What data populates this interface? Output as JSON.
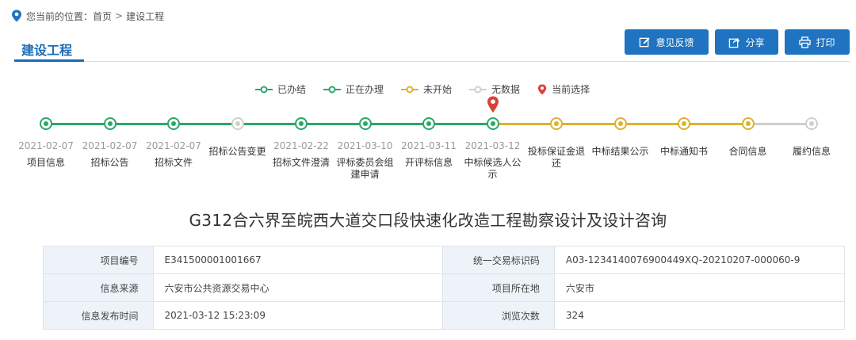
{
  "breadcrumb": {
    "prefix": "您当前的位置：",
    "home": "首页",
    "separator": ">",
    "current": "建设工程"
  },
  "section": {
    "title": "建设工程"
  },
  "actions": {
    "feedback": "意见反馈",
    "share": "分享",
    "print": "打印"
  },
  "legend": {
    "done": "已办结",
    "in_progress": "正在办理",
    "not_started": "未开始",
    "no_data": "无数据",
    "current": "当前选择"
  },
  "colors": {
    "done": "#2aa866",
    "not_started": "#e0b12b",
    "no_data": "#cfcfcf",
    "marker": "#d9423a",
    "accent": "#1f73c0"
  },
  "timeline": {
    "steps": [
      {
        "date": "2021-02-07",
        "label": "项目信息",
        "status": "done"
      },
      {
        "date": "2021-02-07",
        "label": "招标公告",
        "status": "done"
      },
      {
        "date": "2021-02-07",
        "label": "招标文件",
        "status": "done"
      },
      {
        "date": "",
        "label": "招标公告变更",
        "status": "no_data"
      },
      {
        "date": "2021-02-22",
        "label": "招标文件澄清",
        "status": "done"
      },
      {
        "date": "2021-03-10",
        "label": "评标委员会组建申请",
        "status": "done"
      },
      {
        "date": "2021-03-11",
        "label": "开评标信息",
        "status": "done"
      },
      {
        "date": "2021-03-12",
        "label": "中标候选人公示",
        "status": "done"
      },
      {
        "date": "",
        "label": "投标保证金退还",
        "status": "not_started"
      },
      {
        "date": "",
        "label": "中标结果公示",
        "status": "not_started"
      },
      {
        "date": "",
        "label": "中标通知书",
        "status": "not_started"
      },
      {
        "date": "",
        "label": "合同信息",
        "status": "not_started"
      },
      {
        "date": "",
        "label": "履约信息",
        "status": "no_data"
      }
    ]
  },
  "project": {
    "title": "G312合六界至皖西大道交口段快速化改造工程勘察设计及设计咨询"
  },
  "info": {
    "project_no_label": "项目编号",
    "project_no": "E341500001001667",
    "trade_id_label": "统一交易标识码",
    "trade_id": "A03-1234140076900449XQ-20210207-000060-9",
    "source_label": "信息来源",
    "source": "六安市公共资源交易中心",
    "location_label": "项目所在地",
    "location": "六安市",
    "publish_time_label": "信息发布时间",
    "publish_time": "2021-03-12 15:23:09",
    "views_label": "浏览次数",
    "views": "324"
  }
}
